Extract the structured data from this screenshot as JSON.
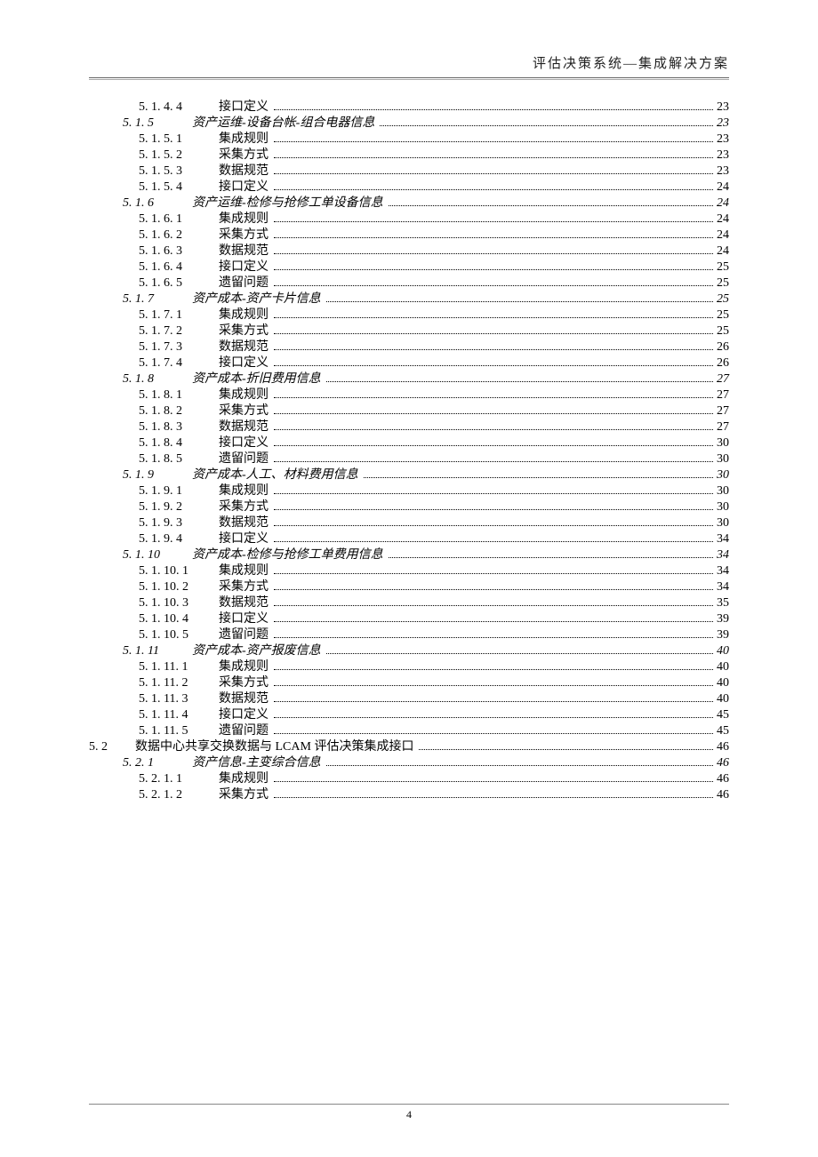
{
  "header": {
    "title": "评估决策系统—集成解决方案"
  },
  "footer": {
    "page_number": "4"
  },
  "toc": [
    {
      "level": 4,
      "num": "5.1.4.4",
      "title": "接口定义",
      "page": "23"
    },
    {
      "level": 3,
      "num": "5.1.5",
      "title": "资产运维-设备台帐-组合电器信息",
      "page": "23"
    },
    {
      "level": 4,
      "num": "5.1.5.1",
      "title": "集成规则",
      "page": "23"
    },
    {
      "level": 4,
      "num": "5.1.5.2",
      "title": "采集方式",
      "page": "23"
    },
    {
      "level": 4,
      "num": "5.1.5.3",
      "title": "数据规范",
      "page": "23"
    },
    {
      "level": 4,
      "num": "5.1.5.4",
      "title": "接口定义",
      "page": "24"
    },
    {
      "level": 3,
      "num": "5.1.6",
      "title": "资产运维-检修与抢修工单设备信息",
      "page": "24"
    },
    {
      "level": 4,
      "num": "5.1.6.1",
      "title": "集成规则",
      "page": "24"
    },
    {
      "level": 4,
      "num": "5.1.6.2",
      "title": "采集方式",
      "page": "24"
    },
    {
      "level": 4,
      "num": "5.1.6.3",
      "title": "数据规范",
      "page": "24"
    },
    {
      "level": 4,
      "num": "5.1.6.4",
      "title": "接口定义",
      "page": "25"
    },
    {
      "level": 4,
      "num": "5.1.6.5",
      "title": "遗留问题",
      "page": "25"
    },
    {
      "level": 3,
      "num": "5.1.7",
      "title": "资产成本-资产卡片信息",
      "page": "25"
    },
    {
      "level": 4,
      "num": "5.1.7.1",
      "title": "集成规则",
      "page": "25"
    },
    {
      "level": 4,
      "num": "5.1.7.2",
      "title": "采集方式",
      "page": "25"
    },
    {
      "level": 4,
      "num": "5.1.7.3",
      "title": "数据规范",
      "page": "26"
    },
    {
      "level": 4,
      "num": "5.1.7.4",
      "title": "接口定义",
      "page": "26"
    },
    {
      "level": 3,
      "num": "5.1.8",
      "title": "资产成本-折旧费用信息",
      "page": "27"
    },
    {
      "level": 4,
      "num": "5.1.8.1",
      "title": "集成规则",
      "page": "27"
    },
    {
      "level": 4,
      "num": "5.1.8.2",
      "title": "采集方式",
      "page": "27"
    },
    {
      "level": 4,
      "num": "5.1.8.3",
      "title": "数据规范",
      "page": "27"
    },
    {
      "level": 4,
      "num": "5.1.8.4",
      "title": "接口定义",
      "page": "30"
    },
    {
      "level": 4,
      "num": "5.1.8.5",
      "title": "遗留问题",
      "page": "30"
    },
    {
      "level": 3,
      "num": "5.1.9",
      "title": "资产成本-人工、材料费用信息",
      "page": "30"
    },
    {
      "level": 4,
      "num": "5.1.9.1",
      "title": "集成规则",
      "page": "30"
    },
    {
      "level": 4,
      "num": "5.1.9.2",
      "title": "采集方式",
      "page": "30"
    },
    {
      "level": 4,
      "num": "5.1.9.3",
      "title": "数据规范",
      "page": "30"
    },
    {
      "level": 4,
      "num": "5.1.9.4",
      "title": "接口定义",
      "page": "34"
    },
    {
      "level": 3,
      "num": "5.1.10",
      "title": "资产成本-检修与抢修工单费用信息",
      "page": "34"
    },
    {
      "level": 4,
      "num": "5.1.10.1",
      "title": "集成规则",
      "page": "34"
    },
    {
      "level": 4,
      "num": "5.1.10.2",
      "title": "采集方式",
      "page": "34"
    },
    {
      "level": 4,
      "num": "5.1.10.3",
      "title": "数据规范",
      "page": "35"
    },
    {
      "level": 4,
      "num": "5.1.10.4",
      "title": "接口定义",
      "page": "39"
    },
    {
      "level": 4,
      "num": "5.1.10.5",
      "title": "遗留问题",
      "page": "39"
    },
    {
      "level": 3,
      "num": "5.1.11",
      "title": "资产成本-资产报废信息",
      "page": "40"
    },
    {
      "level": 4,
      "num": "5.1.11.1",
      "title": "集成规则",
      "page": "40"
    },
    {
      "level": 4,
      "num": "5.1.11.2",
      "title": "采集方式",
      "page": "40"
    },
    {
      "level": 4,
      "num": "5.1.11.3",
      "title": "数据规范",
      "page": "40"
    },
    {
      "level": 4,
      "num": "5.1.11.4",
      "title": "接口定义",
      "page": "45"
    },
    {
      "level": 4,
      "num": "5.1.11.5",
      "title": "遗留问题",
      "page": "45"
    },
    {
      "level": 2,
      "num": "5.2",
      "title": "数据中心共享交换数据与 LCAM 评估决策集成接口",
      "page": "46"
    },
    {
      "level": 3,
      "num": "5.2.1",
      "title": "资产信息-主变综合信息",
      "page": "46"
    },
    {
      "level": 4,
      "num": "5.2.1.1",
      "title": "集成规则",
      "page": "46"
    },
    {
      "level": 4,
      "num": "5.2.1.2",
      "title": "采集方式",
      "page": "46"
    }
  ]
}
